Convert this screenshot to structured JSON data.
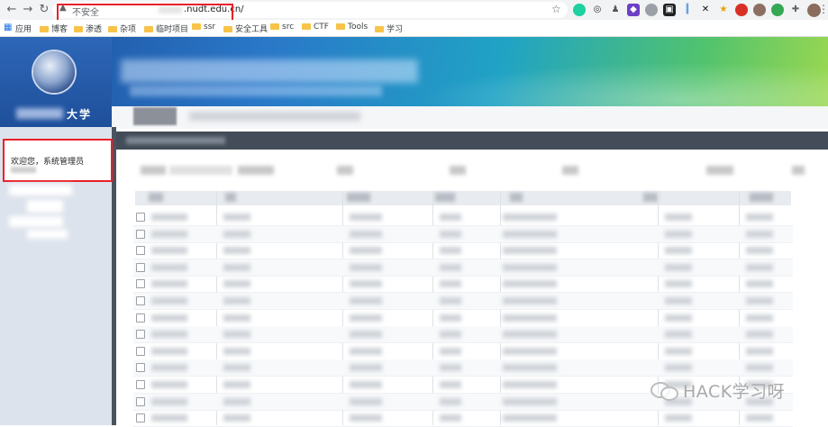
{
  "browser": {
    "security_label": "不安全",
    "url": ".nudt.edu.cn/",
    "bookmarks": [
      {
        "label": "应用"
      },
      {
        "label": "博客"
      },
      {
        "label": "渗透"
      },
      {
        "label": "杂项"
      },
      {
        "label": "临时项目"
      },
      {
        "label": "ssr"
      },
      {
        "label": "安全工具"
      },
      {
        "label": "src"
      },
      {
        "label": "CTF"
      },
      {
        "label": "Tools"
      },
      {
        "label": "学习"
      }
    ]
  },
  "header": {
    "logo_text": "大学"
  },
  "sidebar": {
    "welcome_text": "欢迎您，系统管理员"
  },
  "watermark": {
    "text": "HACK学习呀"
  },
  "colors": {
    "highlight_box": "#e8202a",
    "content_bar": "#434c58",
    "banner_start": "#1d4f9e",
    "banner_end": "#9cd850"
  }
}
